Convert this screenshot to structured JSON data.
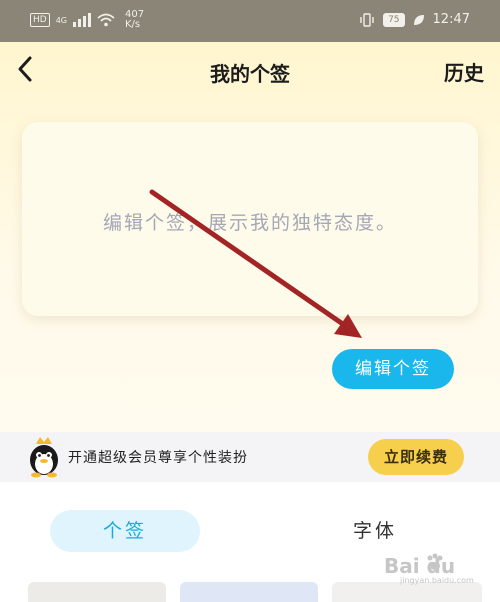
{
  "status_bar": {
    "hd_label": "HD",
    "network_label": "4G",
    "net_speed_value": "407",
    "net_speed_unit": "K/s",
    "battery": "75",
    "time": "12:47"
  },
  "header": {
    "title": "我的个签",
    "history_label": "历史"
  },
  "editor": {
    "placeholder": "编辑个签，展示我的独特态度。",
    "edit_button_label": "编辑个签"
  },
  "vip_banner": {
    "text": "开通超级会员尊享个性装扮",
    "renew_button_label": "立即续费"
  },
  "tabs": [
    {
      "label": "个签",
      "selected": true
    },
    {
      "label": "字体",
      "selected": false
    }
  ],
  "watermark": {
    "brand": "Bai du",
    "sub": "jingyan.baidu.com"
  },
  "colors": {
    "accent_blue": "#1ab7ec",
    "vip_yellow": "#f6cf4c",
    "annotation_arrow": "#a32424"
  }
}
